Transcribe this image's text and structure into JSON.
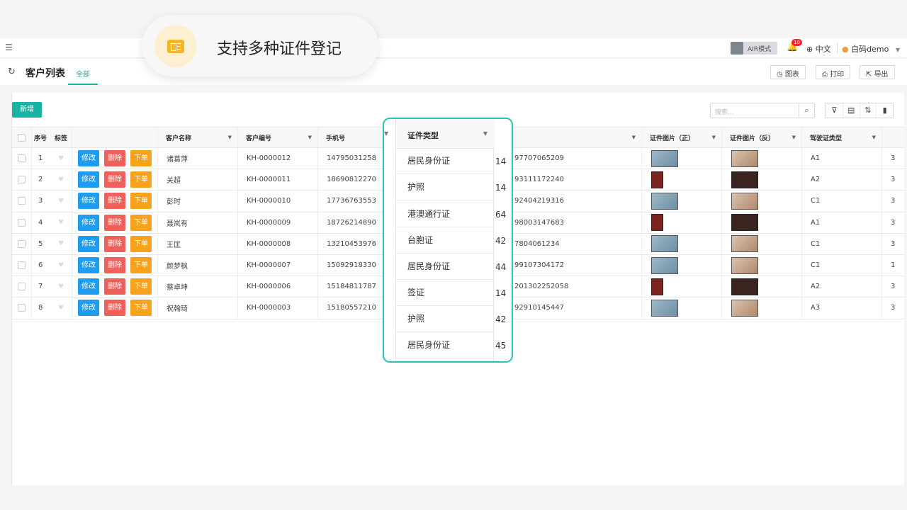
{
  "callout": {
    "text": "支持多种证件登记"
  },
  "topbar": {
    "air_label": "AIR模式",
    "notification_count": "10",
    "language": "中文",
    "user_name": "白码demo"
  },
  "tabbar": {
    "title": "客户列表",
    "tab_all": "全部",
    "chart_btn": "图表",
    "print_btn": "打印",
    "export_btn": "导出"
  },
  "toolbar": {
    "add_label": "新增",
    "search_placeholder": "搜索..."
  },
  "columns": {
    "seq": "序号",
    "tag": "标签",
    "name": "客户名称",
    "code": "客户编号",
    "phone": "手机号",
    "id_type": "证件类型",
    "id_no": "证",
    "photo_front": "证件图片（正）",
    "photo_back": "证件图片（反）",
    "license_type": "驾驶证类型"
  },
  "actions": {
    "edit": "修改",
    "delete": "删除",
    "order": "下单"
  },
  "rows": [
    {
      "seq": "1",
      "name": "诸葛萍",
      "code": "KH-0000012",
      "phone": "14795031258",
      "id_no": "97707065209",
      "license": "A1",
      "extra": "3"
    },
    {
      "seq": "2",
      "name": "关超",
      "code": "KH-0000011",
      "phone": "18690812270",
      "id_no": "93111172240",
      "license": "A2",
      "extra": "3"
    },
    {
      "seq": "3",
      "name": "彭时",
      "code": "KH-0000010",
      "phone": "17736763553",
      "id_no": "92404219316",
      "license": "C1",
      "extra": "3"
    },
    {
      "seq": "4",
      "name": "聂岚有",
      "code": "KH-0000009",
      "phone": "18726214890",
      "id_no": "98003147683",
      "license": "A1",
      "extra": "3"
    },
    {
      "seq": "5",
      "name": "王匡",
      "code": "KH-0000008",
      "phone": "13210453976",
      "id_no": "7804061234",
      "license": "C1",
      "extra": "3"
    },
    {
      "seq": "6",
      "name": "颜梦枫",
      "code": "KH-0000007",
      "phone": "15092918330",
      "id_no": "99107304172",
      "license": "C1",
      "extra": "1"
    },
    {
      "seq": "7",
      "name": "蔡卓坤",
      "code": "KH-0000006",
      "phone": "15184811787",
      "id_no": "201302252058",
      "license": "A2",
      "extra": "3"
    },
    {
      "seq": "8",
      "name": "祝翰琦",
      "code": "KH-0000003",
      "phone": "15180557210",
      "id_no": "92910145447",
      "license": "A3",
      "extra": "3"
    }
  ],
  "popup": {
    "header": "证件类型",
    "items": [
      "居民身份证",
      "护照",
      "港澳通行证",
      "台胞证",
      "居民身份证",
      "签证",
      "护照",
      "居民身份证"
    ],
    "right_digits": [
      "14",
      "14",
      "64",
      "42",
      "44",
      "14",
      "42",
      "45"
    ]
  }
}
